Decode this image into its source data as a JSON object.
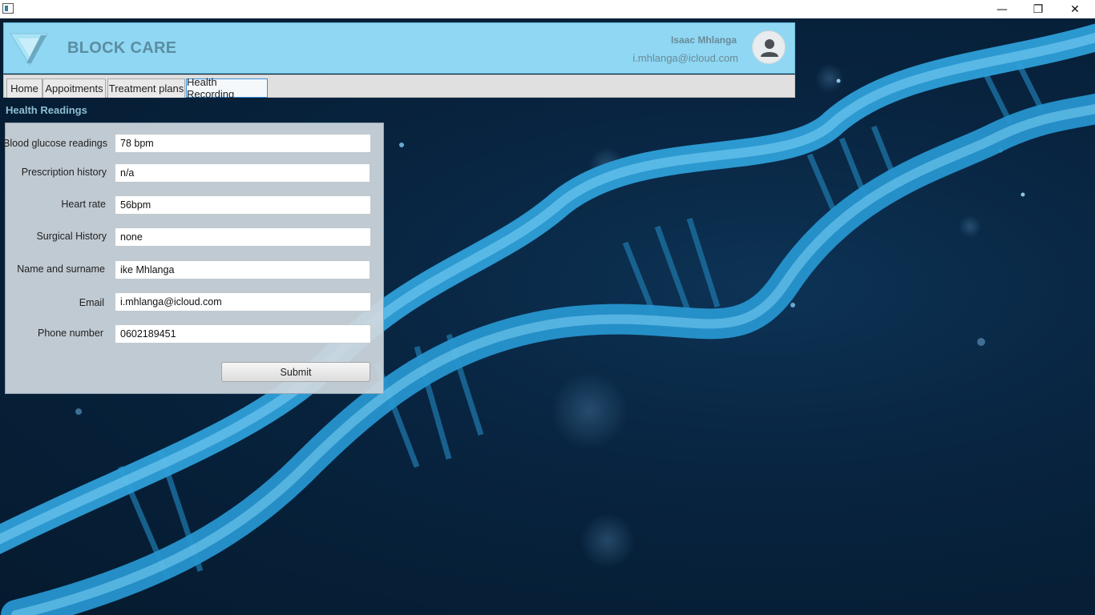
{
  "window": {
    "minimize_glyph": "—",
    "maximize_glyph": "❐",
    "close_glyph": "✕"
  },
  "header": {
    "brand": "BLOCK CARE",
    "user_name": "Isaac Mhlanga",
    "user_email": "i.mhlanga@icloud.com"
  },
  "tabs": [
    {
      "label": "Home"
    },
    {
      "label": "Appoitments"
    },
    {
      "label": "Treatment plans"
    },
    {
      "label": "Health Recording",
      "active": true
    }
  ],
  "form": {
    "title": "Health Readings",
    "fields": [
      {
        "label": "Blood glucose readings",
        "value": "78 bpm"
      },
      {
        "label": "Prescription history",
        "value": "n/a"
      },
      {
        "label": "Heart rate",
        "value": "56bpm"
      },
      {
        "label": "Surgical History",
        "value": "none"
      },
      {
        "label": "Name and surname",
        "value": "ike Mhlanga"
      },
      {
        "label": "Email",
        "value": "i.mhlanga@icloud.com"
      },
      {
        "label": "Phone number",
        "value": "0602189451"
      }
    ],
    "submit_label": "Submit"
  },
  "colors": {
    "header_bg": "#8fd7f2",
    "brand_text": "#5b8da3",
    "section_title": "#8fbfd4",
    "active_tab_border": "#3a8fd6"
  }
}
